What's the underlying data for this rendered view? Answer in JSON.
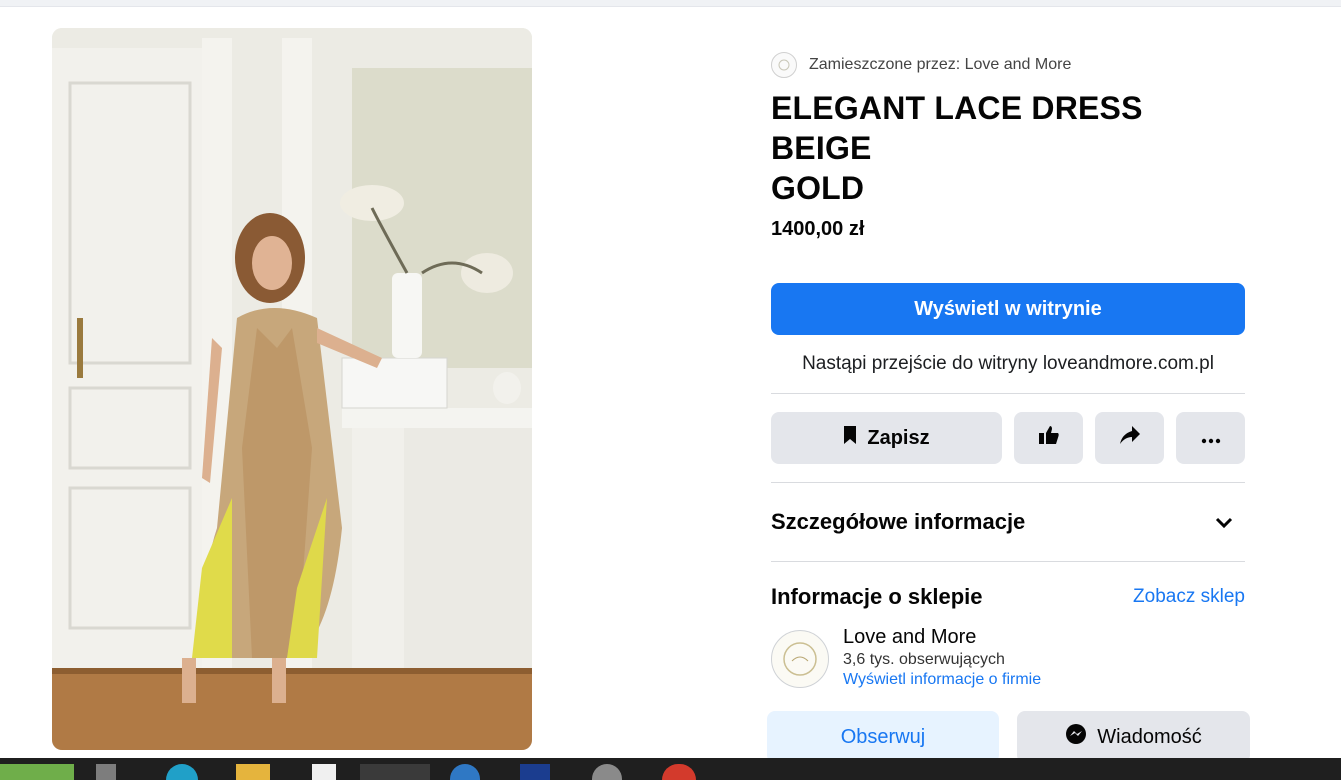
{
  "product": {
    "posted_by": "Zamieszczone przez: Love and More",
    "title_line1": "ELEGANT LACE DRESS BEIGE",
    "title_line2": "GOLD",
    "price": "1400,00 zł"
  },
  "primary_action": {
    "label": "Wyświetl w witrynie",
    "note": "Nastąpi przejście do witryny loveandmore.com.pl"
  },
  "actions": {
    "save_label": "Zapisz",
    "like_icon": "thumbs-up-icon",
    "share_icon": "share-arrow-icon",
    "more_icon": "more-dots-icon"
  },
  "details": {
    "label": "Szczegółowe informacje"
  },
  "shop": {
    "section_title": "Informacje o sklepie",
    "see_shop_link": "Zobacz sklep",
    "name": "Love and More",
    "followers": "3,6 tys. obserwujących",
    "business_info_link": "Wyświetl informacje o firmie"
  },
  "bottom": {
    "follow_label": "Obserwuj",
    "message_label": "Wiadomość"
  },
  "colors": {
    "accent": "#1877f2",
    "button_gray": "#e4e6eb",
    "follow_bg": "#e7f3ff",
    "taskbar": "#1f1f1f"
  }
}
